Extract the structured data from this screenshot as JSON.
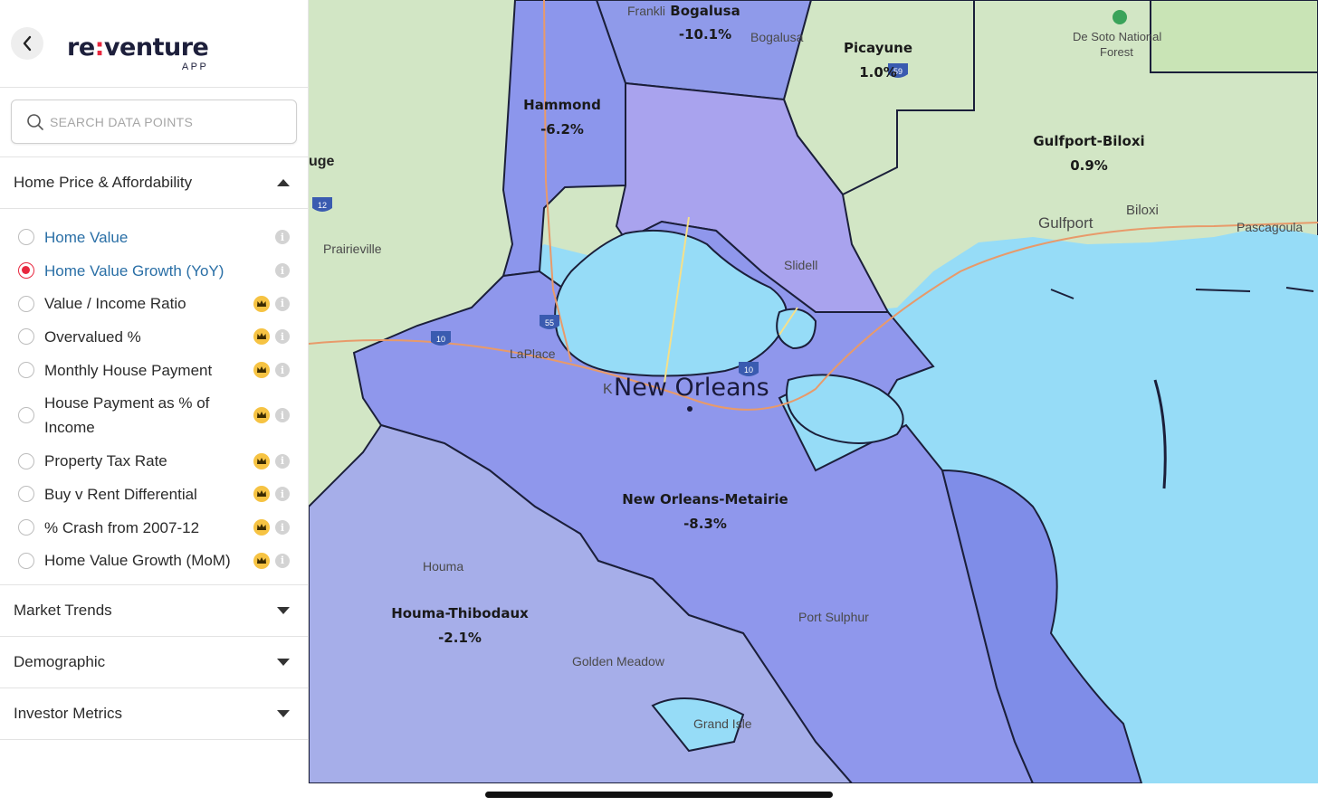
{
  "app": {
    "logo_re": "re",
    "logo_colon": ":",
    "logo_venture": "venture",
    "logo_sub": "APP"
  },
  "search": {
    "placeholder": "SEARCH DATA POINTS"
  },
  "sections": {
    "home_price": {
      "label": "Home Price & Affordability",
      "expanded": true
    },
    "market_trends": {
      "label": "Market Trends"
    },
    "demographic": {
      "label": "Demographic"
    },
    "investor_metrics": {
      "label": "Investor Metrics"
    }
  },
  "options": [
    {
      "label": "Home Value",
      "premium": false,
      "selected": false
    },
    {
      "label": "Home Value Growth (YoY)",
      "premium": false,
      "selected": true
    },
    {
      "label": "Value / Income Ratio",
      "premium": true,
      "selected": false
    },
    {
      "label": "Overvalued %",
      "premium": true,
      "selected": false
    },
    {
      "label": "Monthly House Payment",
      "premium": true,
      "selected": false
    },
    {
      "label": "House Payment as % of Income",
      "premium": true,
      "selected": false
    },
    {
      "label": "Property Tax Rate",
      "premium": true,
      "selected": false
    },
    {
      "label": "Buy v Rent Differential",
      "premium": true,
      "selected": false
    },
    {
      "label": "% Crash from 2007-12",
      "premium": true,
      "selected": false
    },
    {
      "label": "Home Value Growth (MoM)",
      "premium": true,
      "selected": false
    }
  ],
  "info_glyph": "i",
  "map": {
    "colors": {
      "water": "#96dcf7",
      "land": "#d2e6c5",
      "region_purple": "#8c96ec",
      "region_light": "#a9a3ee",
      "border": "#1b1f3a",
      "highway": "#e89a6a"
    },
    "regions": [
      {
        "name": "Bogalusa",
        "value": "-10.1%"
      },
      {
        "name": "Picayune",
        "value": "1.0%"
      },
      {
        "name": "Hammond",
        "value": "-6.2%"
      },
      {
        "name": "Gulfport-Biloxi",
        "value": "0.9%"
      },
      {
        "name": "New Orleans-Metairie",
        "value": "-8.3%"
      },
      {
        "name": "Houma-Thibodaux",
        "value": "-2.1%"
      }
    ],
    "places": {
      "new_orleans": "New Orleans",
      "franklinton": "Frankli",
      "bogalusa_town": "Bogalusa",
      "desoto": "De Soto National",
      "desoto2": "Forest",
      "gulfport": "Gulfport",
      "biloxi": "Biloxi",
      "pascagoula": "Pascagoula",
      "baton_rouge": "uge",
      "prairieville": "Prairieville",
      "slidell": "Slidell",
      "laplace": "LaPlace",
      "kenner": "K",
      "houma": "Houma",
      "golden_meadow": "Golden Meadow",
      "port_sulphur": "Port Sulphur",
      "grand_isle": "Grand Isle"
    },
    "shields": {
      "i12": "12",
      "i10_west": "10",
      "i55": "55",
      "i10_east": "10",
      "i59": "59"
    }
  }
}
